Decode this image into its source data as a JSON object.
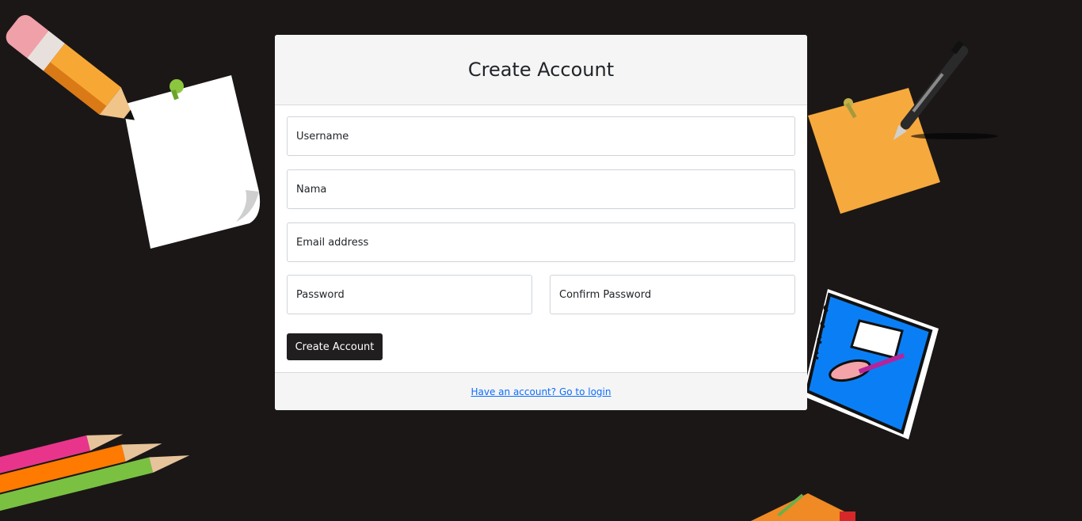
{
  "form": {
    "title": "Create Account",
    "username_placeholder": "Username",
    "nama_placeholder": "Nama",
    "email_placeholder": "Email address",
    "password_placeholder": "Password",
    "confirm_password_placeholder": "Confirm Password",
    "submit_label": "Create Account",
    "login_link_text": "Have an account? Go to login"
  },
  "decor": {
    "items": [
      "pencil-illustration",
      "sticky-note-illustration",
      "orange-note-illustration",
      "pen-illustration",
      "notebook-illustration",
      "colored-pencils-illustration",
      "book-illustration"
    ]
  },
  "colors": {
    "background": "#1b1717",
    "button": "#211e1f",
    "link": "#0d6efd",
    "header_bg": "#f5f5f5"
  }
}
